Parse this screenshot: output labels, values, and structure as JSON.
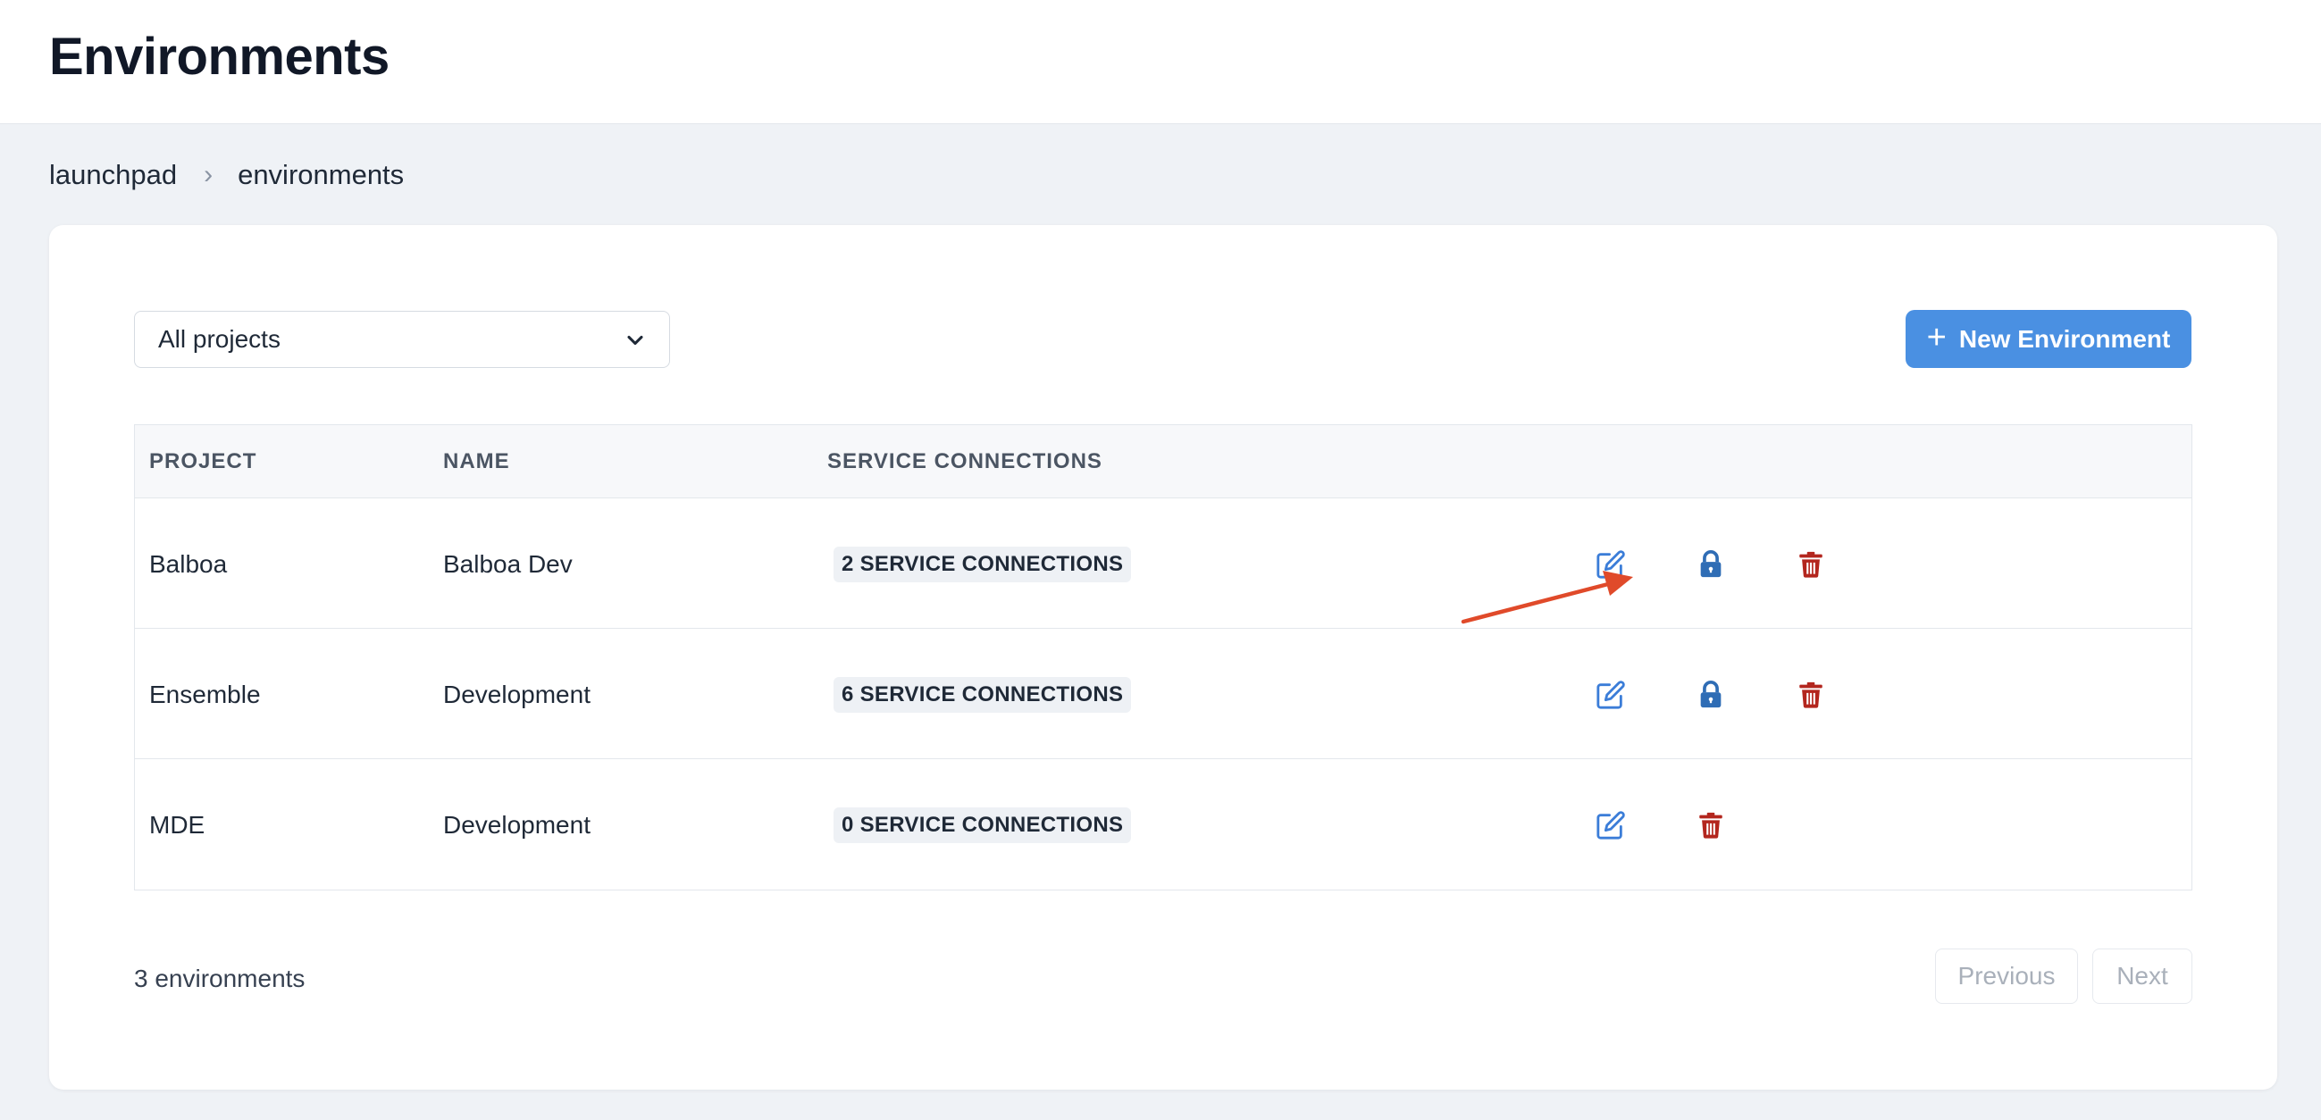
{
  "header": {
    "title": "Environments"
  },
  "breadcrumb": {
    "items": [
      "launchpad",
      "environments"
    ],
    "separator": "›"
  },
  "filter": {
    "selected": "All projects"
  },
  "toolbar": {
    "new_label": "New Environment",
    "new_icon": "plus-icon"
  },
  "table": {
    "columns": [
      "PROJECT",
      "NAME",
      "SERVICE CONNECTIONS"
    ],
    "rows": [
      {
        "project": "Balboa",
        "name": "Balboa Dev",
        "connections": "2 SERVICE CONNECTIONS",
        "actions": [
          "edit",
          "lock",
          "delete"
        ]
      },
      {
        "project": "Ensemble",
        "name": "Development",
        "connections": "6 SERVICE CONNECTIONS",
        "actions": [
          "edit",
          "lock",
          "delete"
        ]
      },
      {
        "project": "MDE",
        "name": "Development",
        "connections": "0 SERVICE CONNECTIONS",
        "actions": [
          "edit",
          "delete"
        ]
      }
    ]
  },
  "footer": {
    "count": "3 environments",
    "previous": "Previous",
    "next": "Next"
  },
  "colors": {
    "primary": "#4a90e2",
    "edit": "#3b7dd8",
    "lock": "#2f6db5",
    "delete": "#b3261e",
    "annotation": "#e04a2a"
  }
}
